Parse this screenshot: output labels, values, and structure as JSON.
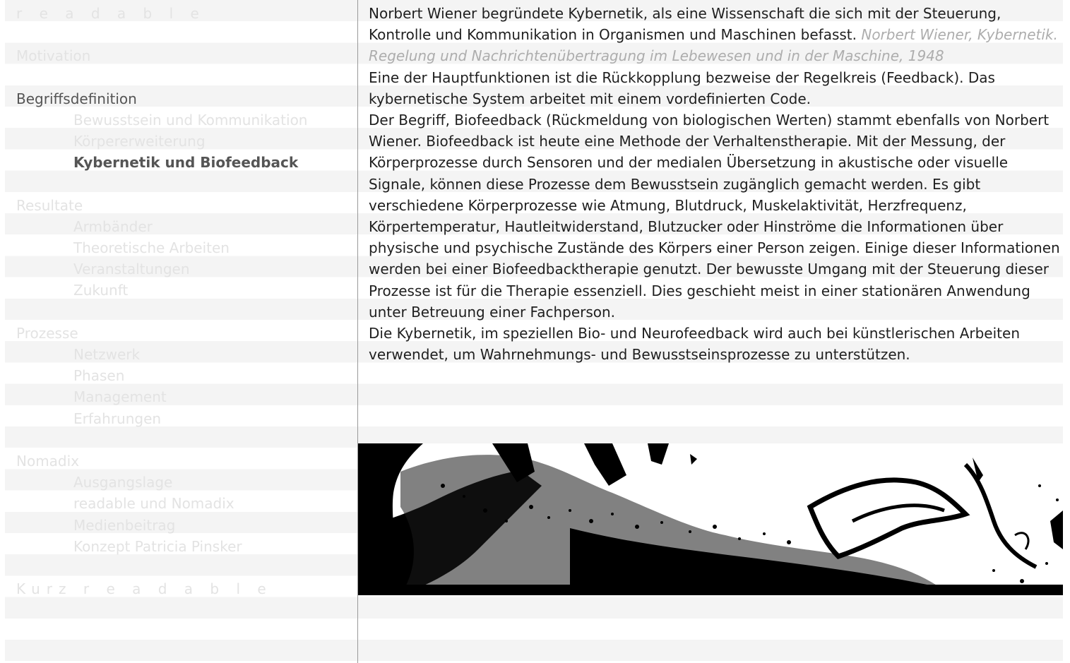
{
  "nav": {
    "brand": "r e a d a b l e",
    "motivation": "Motivation",
    "begriffsdefinition": "Begriffsdefinition",
    "bewusstsein": "Bewusstsein und Kommunikation",
    "koerpererweiterung": "Körpererweiterung",
    "kybernetik": "Kybernetik und Biofeedback",
    "resultate": "Resultate",
    "armbaender": "Armbänder",
    "theoretische": "Theoretische Arbeiten",
    "veranstaltungen": "Veranstaltungen",
    "zukunft": "Zukunft",
    "prozesse": "Prozesse",
    "netzwerk": "Netzwerk",
    "phasen": "Phasen",
    "management": "Management",
    "erfahrungen": "Erfahrungen",
    "nomadix": "Nomadix",
    "ausgangslage": "Ausgangslage",
    "readable_nomadix": "readable und Nomadix",
    "medienbeitrag": "Medienbeitrag",
    "konzept": "Konzept Patricia Pinsker",
    "kurz_readable": "Kurz r e a d a b l e"
  },
  "content": {
    "p1_text": "Norbert Wiener begründete Kybernetik, als eine Wissenschaft die sich mit der Steuerung, Kontrolle und Kommunikation in Organismen und Maschinen befasst.",
    "p1_cite": "Norbert Wiener, Kybernetik. Regelung und Nachrichtenübertragung im Lebewesen und in der Maschine, 1948",
    "p2": "Eine der Hauptfunktionen ist die Rückkopplung bezweise der Regelkreis (Feedback). Das kybernetische System arbeitet mit einem vordefinierten Code.",
    "p3": "Der Begriff, Biofeedback (Rückmeldung von biologischen Werten) stammt ebenfalls von Norbert Wiener. Biofeedback ist heute eine Methode der Verhaltenstherapie. Mit der Messung, der Körperprozesse durch Sensoren und der medialen Übersetzung in akusti­sche oder visuelle Signale, können diese Prozesse dem Bewusstsein zugänglich gemacht werden. Es gibt verschiedene Körperprozesse wie Atmung, Blutdruck, Muskelaktivität, Herzfrequenz, Körpertemperatur, Hautleitwiderstand, Blutzucker oder Hinströme die Informationen über physische und psychische Zustände des Körpers einer Person zeigen. Einige dieser Informationen werden bei einer Biofeedbacktherapie genutzt. Der bewusste Umgang mit der Steuerung dieser Prozesse ist für die Therapie essenziell. Dies geschieht meist in einer stationären Anwendung unter Betreuung einer Fachperson.",
    "p4": "Die Kybernetik, im speziellen Bio- und Neurofeedback wird auch bei künstlerischen Arbei­ten verwendet, um Wahrnehmungs- und Bewusstseinsprozesse zu unterstützen."
  }
}
